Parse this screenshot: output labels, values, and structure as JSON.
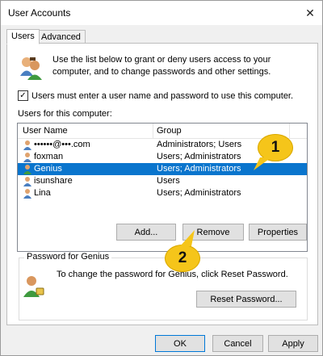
{
  "window": {
    "title": "User Accounts",
    "close_glyph": "✕"
  },
  "tabs": [
    {
      "label": "Users",
      "active": true
    },
    {
      "label": "Advanced",
      "active": false
    }
  ],
  "intro_text": "Use the list below to grant or deny users access to your computer, and to change passwords and other settings.",
  "checkbox": {
    "label": "Users must enter a user name and password to use this computer.",
    "checked": true,
    "glyph": "✓"
  },
  "users_label": "Users for this computer:",
  "table": {
    "columns": [
      "User Name",
      "Group"
    ],
    "rows": [
      {
        "name": "••••••@•••.com",
        "group": "Administrators; Users",
        "selected": false
      },
      {
        "name": "foxman",
        "group": "Users; Administrators",
        "selected": false
      },
      {
        "name": "Genius",
        "group": "Users; Administrators",
        "selected": true
      },
      {
        "name": "isunshare",
        "group": "Users",
        "selected": false
      },
      {
        "name": "Lina",
        "group": "Users; Administrators",
        "selected": false
      }
    ]
  },
  "buttons": {
    "add": "Add...",
    "remove": "Remove",
    "properties": "Properties",
    "reset_password": "Reset Password...",
    "ok": "OK",
    "cancel": "Cancel",
    "apply": "Apply"
  },
  "password_group": {
    "title": "Password for Genius",
    "text": "To change the password for Genius, click Reset Password."
  },
  "callouts": [
    "1",
    "2"
  ],
  "colors": {
    "selection": "#0a75cd",
    "callout": "#f5c51a"
  }
}
